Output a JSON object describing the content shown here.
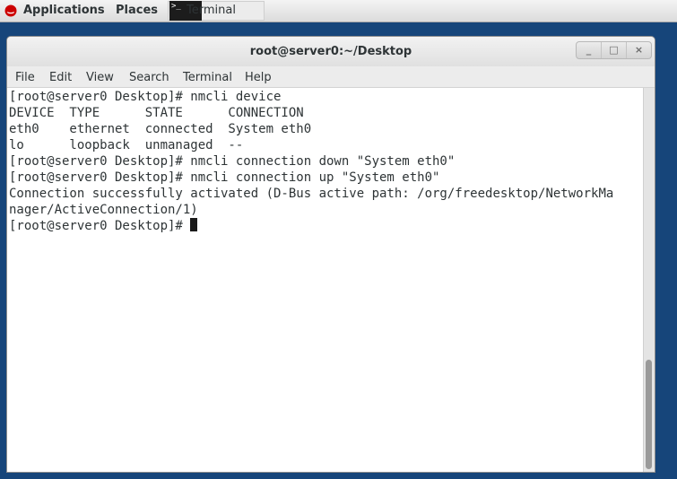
{
  "top_panel": {
    "applications": "Applications",
    "places": "Places",
    "task": "Terminal"
  },
  "window": {
    "title": "root@server0:~/Desktop",
    "buttons": {
      "minimize": "_",
      "maximize": "□",
      "close": "×"
    }
  },
  "menu": {
    "file": "File",
    "edit": "Edit",
    "view": "View",
    "search": "Search",
    "terminal": "Terminal",
    "help": "Help"
  },
  "terminal": {
    "lines": [
      "[root@server0 Desktop]# nmcli device",
      "DEVICE  TYPE      STATE      CONNECTION",
      "eth0    ethernet  connected  System eth0",
      "lo      loopback  unmanaged  --",
      "[root@server0 Desktop]# nmcli connection down \"System eth0\"",
      "[root@server0 Desktop]# nmcli connection up \"System eth0\"",
      "Connection successfully activated (D-Bus active path: /org/freedesktop/NetworkMa",
      "nager/ActiveConnection/1)",
      "[root@server0 Desktop]# "
    ]
  },
  "icons": {
    "applications": "redhat-icon",
    "task": "terminal-icon"
  },
  "colors": {
    "desktop": "#16457a",
    "panel": "#e4e4e4",
    "terminal_bg": "#ffffff",
    "terminal_fg": "#2e3436"
  }
}
